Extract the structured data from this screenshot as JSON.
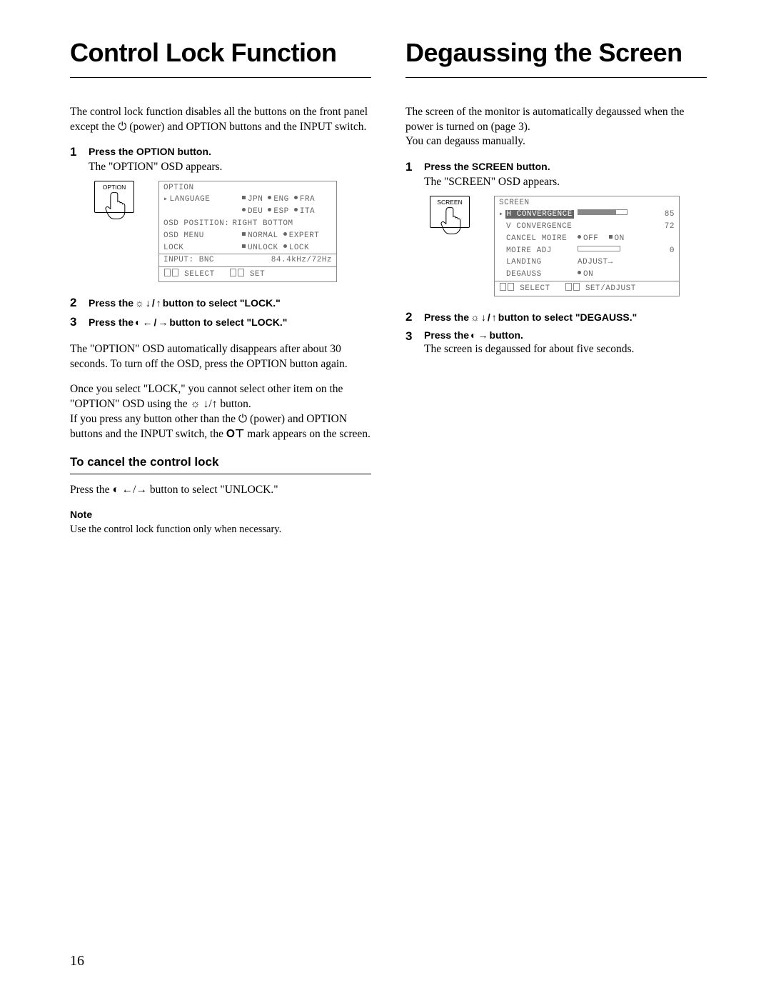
{
  "page_number": "16",
  "left": {
    "title": "Control Lock Function",
    "intro_a": "The control lock function disables all the buttons on the front panel except the ",
    "intro_b": " (power) and OPTION buttons and the INPUT switch.",
    "step1_bold": "Press the OPTION button.",
    "step1_follow": "The \"OPTION\" OSD appears.",
    "button_label": "OPTION",
    "osd": {
      "title": "OPTION",
      "row1_label": "LANGUAGE",
      "row1_vals": [
        "JPN",
        "ENG",
        "FRA"
      ],
      "row1b_vals": [
        "DEU",
        "ESP",
        "ITA"
      ],
      "row2_label": "OSD POSITION:",
      "row2_vals": [
        "RIGHT",
        "BOTTOM"
      ],
      "row3_label": "OSD MENU",
      "row3_vals": [
        "NORMAL",
        "EXPERT"
      ],
      "row4_label": "LOCK",
      "row4_vals": [
        "UNLOCK",
        "LOCK"
      ],
      "input_line_a": "INPUT:",
      "input_line_b": "BNC",
      "input_line_c": "84.4kHz/72Hz",
      "footer_a": "SELECT",
      "footer_b": "SET"
    },
    "step2_a": "Press the ",
    "step2_b": " button to select \"LOCK.\"",
    "step3_a": "Press the ",
    "step3_b": " button to select \"LOCK.\"",
    "p_after_a": "The \"OPTION\" OSD automatically disappears after about 30 seconds. To turn off the OSD, press the OPTION button again.",
    "p_once_a": "Once you select \"LOCK,\" you cannot select other item on the \"OPTION\" OSD using the ",
    "p_once_b": " button.",
    "p_once_c": "If you press any button other than the ",
    "p_once_d": " (power) and OPTION buttons and the INPUT switch, the ",
    "p_once_e": " mark appears on the screen.",
    "cancel_heading": "To cancel the control lock",
    "cancel_text_a": "Press the ",
    "cancel_text_b": " button to select \"UNLOCK.\"",
    "note_label": "Note",
    "note_text": "Use the control lock function only when necessary."
  },
  "right": {
    "title": "Degaussing the Screen",
    "intro": "The screen of the monitor is automatically degaussed when the power is turned on (page 3).",
    "intro2": "You can degauss manually.",
    "step1_bold": "Press the SCREEN button.",
    "step1_follow": "The \"SCREEN\" OSD appears.",
    "button_label": "SCREEN",
    "osd": {
      "title": "SCREEN",
      "r1": "H CONVERGENCE",
      "v1": "85",
      "r2": "V CONVERGENCE",
      "v2": "72",
      "r3": "CANCEL MOIRE",
      "r3a": "OFF",
      "r3b": "ON",
      "r4": "MOIRE ADJ",
      "v4": "0",
      "r5": "LANDING",
      "r5v": "ADJUST",
      "r6": "DEGAUSS",
      "r6v": "ON",
      "footer_a": "SELECT",
      "footer_b": "SET/ADJUST"
    },
    "step2_a": "Press the ",
    "step2_b": " button to select \"DEGAUSS.\"",
    "step3_a": "Press the ",
    "step3_b": " button.",
    "step3_follow": "The screen is degaussed for about five seconds."
  }
}
